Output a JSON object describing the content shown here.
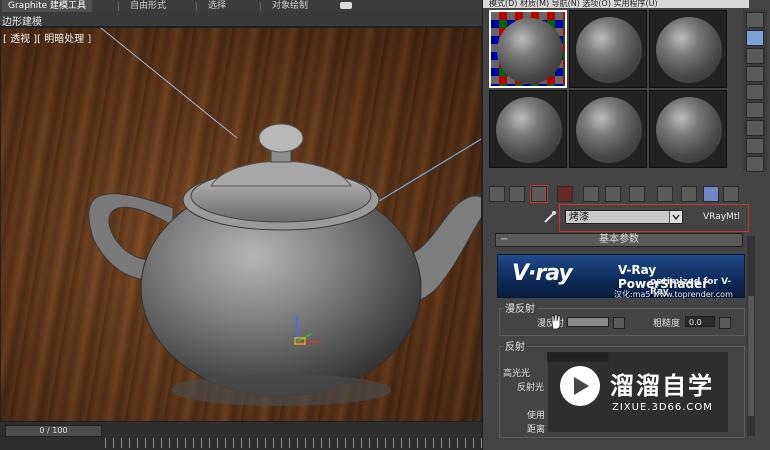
{
  "ribbon": {
    "tabs": [
      "Graphite 建模工具",
      "自由形式",
      "选择",
      "对象绘制"
    ],
    "subtitle": "边形建模"
  },
  "viewport": {
    "label": "[ 透视 ][ 明暗处理 ]",
    "object": "teapot"
  },
  "timeline": {
    "frame_readout": "0 / 100"
  },
  "material_editor": {
    "menu": "模式(D)  材质(M)  导航(N)  选项(O)  实用程序(U)",
    "material_name": "烤漆",
    "material_type": "VRayMtl",
    "rollout_title": "基本参数",
    "banner": {
      "logo": "V·ray",
      "title": "V-Ray PowerShader",
      "subtitle": "optimized for V-Ray",
      "credit": "汉化:ma5 www.toprender.com"
    },
    "diffuse_group": {
      "label": "漫反射",
      "diffuse_label": "漫反射",
      "roughness_label": "粗糙度",
      "roughness_value": "0.0"
    },
    "reflection_group": {
      "label": "反射",
      "highlight_label": "高光光",
      "reflect_label": "反射光",
      "use_label": "使用",
      "distance_label": "距离"
    }
  },
  "watermark": {
    "title": "溜溜自学",
    "url": "ZIXUE.3D66.COM"
  },
  "colors": {
    "accent_red": "#d03030",
    "vray_blue": "#0e2a5a",
    "wood": "#6b3c1d"
  }
}
